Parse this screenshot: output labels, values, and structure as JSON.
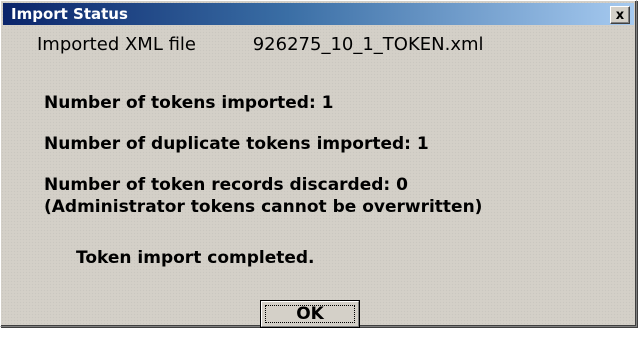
{
  "window": {
    "title": "Import Status",
    "close_symbol": "x",
    "close_icon": "close-icon"
  },
  "file": {
    "label": "Imported XML file",
    "name": "926275_10_1_TOKEN.xml"
  },
  "status": {
    "tokens_imported": "Number of tokens imported: 1",
    "duplicates_imported": "Number of duplicate tokens imported: 1",
    "records_discarded": "Number of token records discarded: 0",
    "admin_note": "(Administrator tokens cannot be overwritten)",
    "completed": "Token import completed."
  },
  "buttons": {
    "ok_label": "OK"
  },
  "colors": {
    "title_start": "#0a246a",
    "title_end": "#a6caf0",
    "face": "#d4d0c8"
  }
}
